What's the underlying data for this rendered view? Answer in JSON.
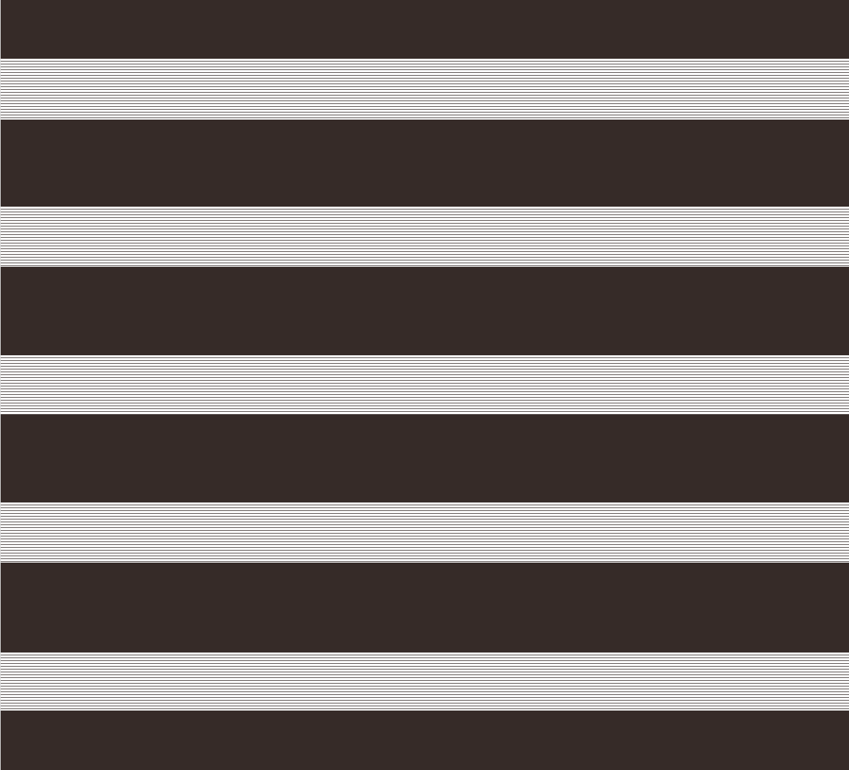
{
  "colors": {
    "dark_band": "#362b28",
    "sheer_line": "#5a5250",
    "background": "#ffffff"
  },
  "pattern": {
    "kind": "horizontal-stripes",
    "dark_band_count": 6,
    "sheer_band_count": 5
  }
}
